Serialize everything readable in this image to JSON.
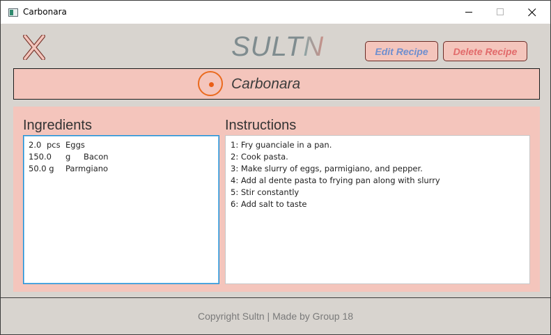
{
  "window": {
    "title": "Carbonara"
  },
  "header": {
    "logo": {
      "main": "SULT",
      "accent": "N"
    },
    "edit_label": "Edit Recipe",
    "delete_label": "Delete Recipe"
  },
  "recipe": {
    "name": "Carbonara"
  },
  "ingredients": {
    "title": "Ingredients",
    "items": [
      {
        "amount": "2.0",
        "unit": "pcs",
        "name": "Eggs"
      },
      {
        "amount": "150.0",
        "unit": "g",
        "name": "Bacon"
      },
      {
        "amount": "50.0 g",
        "unit": "",
        "name": "Parmgiano"
      }
    ]
  },
  "instructions": {
    "title": "Instructions",
    "steps": [
      "1: Fry guanciale in a pan.",
      "2: Cook pasta.",
      "3: Make slurry of eggs, parmigiano, and pepper.",
      "4: Add al dente pasta to frying pan along with slurry",
      "5: Stir constantly",
      "6: Add salt to taste"
    ]
  },
  "footer": {
    "text": "Copyright Sultn | Made by Group 18"
  },
  "colors": {
    "accent": "#f4c5bc",
    "background": "#d8d4cf",
    "edit": "#6f8fcf",
    "delete": "#e26b6b",
    "category": "#ea6a1e"
  },
  "icons": {
    "close": "x-icon",
    "category": "category-circle-icon"
  }
}
